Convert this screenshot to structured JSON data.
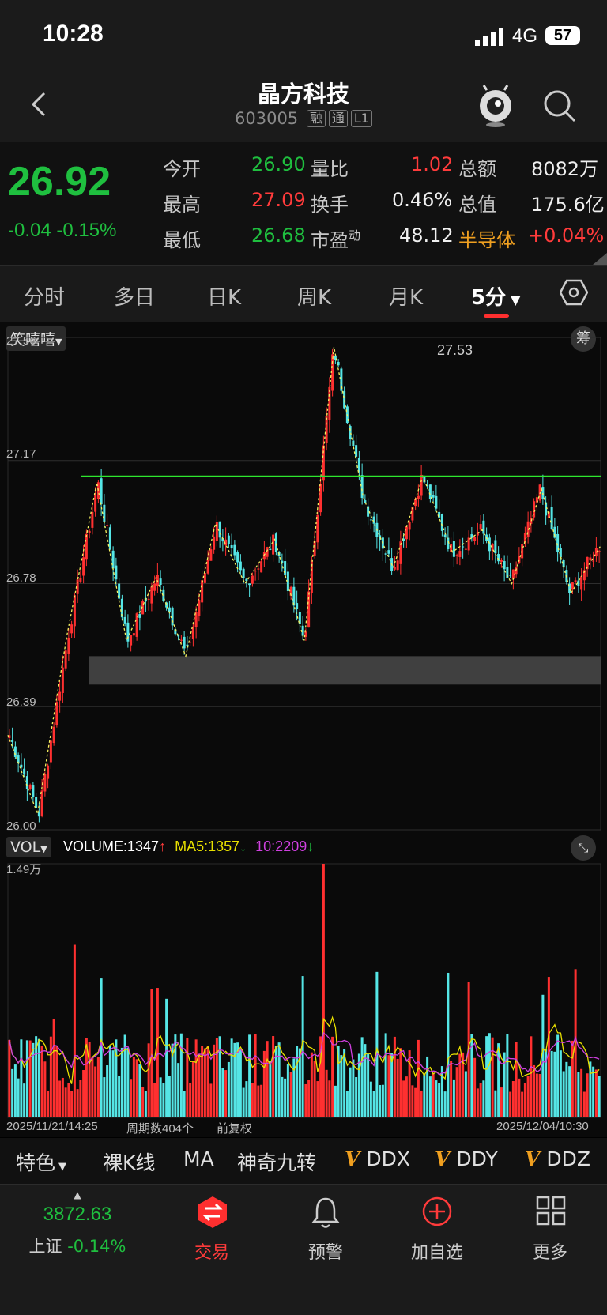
{
  "status_bar": {
    "time": "10:28",
    "network": "4G",
    "battery": "57"
  },
  "header": {
    "title": "晶方科技",
    "code": "603005",
    "tags": [
      "融",
      "通",
      "L1"
    ]
  },
  "quote": {
    "price": "26.92",
    "change": "-0.04",
    "change_pct": "-0.15%",
    "fields": [
      {
        "label": "今开",
        "value": "26.90",
        "color": "#1fbf3f"
      },
      {
        "label": "量比",
        "value": "1.02",
        "color": "#ff3b3b"
      },
      {
        "label": "总额",
        "value": "8082万",
        "color": "#f0f0f0"
      },
      {
        "label": "最高",
        "value": "27.09",
        "color": "#ff3b3b"
      },
      {
        "label": "换手",
        "value": "0.46%",
        "color": "#f0f0f0"
      },
      {
        "label": "总值",
        "value": "175.6亿",
        "color": "#f0f0f0"
      },
      {
        "label": "最低",
        "value": "26.68",
        "color": "#1fbf3f"
      },
      {
        "label": "市盈",
        "label_sup": "动",
        "value": "48.12",
        "color": "#f0f0f0"
      }
    ],
    "sector": "半导体",
    "sector_change": "+0.04%"
  },
  "tabs": [
    "分时",
    "多日",
    "日K",
    "周K",
    "月K",
    "5分"
  ],
  "active_tab": "5分",
  "chart_panel": {
    "indicator_select": "笑嘻嘻",
    "chip_label": "筹",
    "y_ticks": [
      "27.56",
      "27.17",
      "26.78",
      "26.39",
      "26.00"
    ],
    "peak_label": "27.53",
    "vol_select": "VOL",
    "vol_legend": {
      "volume": "VOLUME:1347",
      "volume_arrow": "↑",
      "ma5": "MA5:1357",
      "ma5_arrow": "↓",
      "ma10": "10:2209",
      "ma10_arrow": "↓"
    },
    "vol_max_label": "1.49万",
    "start_time": "2025/11/21/14:25",
    "period_count": "周期数404个",
    "adjust": "前复权",
    "end_time": "2025/12/04/10:30"
  },
  "indicator_bar": {
    "items": [
      "特色",
      "裸K线",
      "MA",
      "神奇九转",
      "DDX",
      "DDY",
      "DDZ"
    ],
    "v_mark": "V"
  },
  "bottom_nav": {
    "index_value": "3872.63",
    "index_name": "上证",
    "index_change": "-0.14%",
    "items": [
      {
        "label": "交易"
      },
      {
        "label": "预警"
      },
      {
        "label": "加自选"
      },
      {
        "label": "更多"
      }
    ]
  },
  "chart_data": {
    "type": "candlestick",
    "interval": "5分",
    "ylim": [
      26.0,
      27.56
    ],
    "y_ticks": [
      27.56,
      27.17,
      26.78,
      26.39,
      26.0
    ],
    "resistance_line": 27.12,
    "support_zone": [
      26.46,
      26.55
    ],
    "zigzag_close_approx": [
      26.3,
      26.05,
      26.62,
      27.1,
      26.6,
      26.8,
      26.55,
      26.97,
      26.78,
      26.92,
      26.6,
      27.53,
      27.05,
      26.83,
      27.12,
      26.88,
      26.95,
      26.78,
      27.08,
      26.75,
      26.9
    ],
    "peak_value": 27.53,
    "volume_max": 14900,
    "volume_last": 1347,
    "ma5_last": 1357,
    "ma10_last": 2209
  }
}
